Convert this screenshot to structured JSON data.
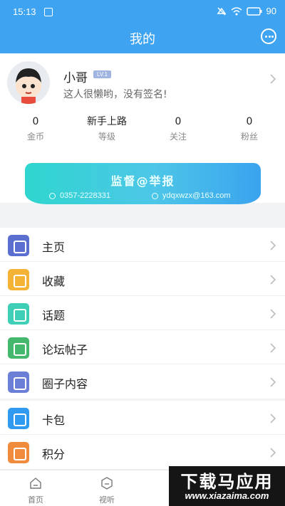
{
  "status_bar": {
    "time": "15:13",
    "battery": "90"
  },
  "header": {
    "title": "我的"
  },
  "profile": {
    "username": "小哥",
    "level": "LV.1",
    "signature": "这人很懒哟，没有签名!",
    "stats": [
      {
        "value": "0",
        "label": "金币"
      },
      {
        "value": "新手上路",
        "label": "等级"
      },
      {
        "value": "0",
        "label": "关注"
      },
      {
        "value": "0",
        "label": "粉丝"
      }
    ]
  },
  "banner": {
    "title": "监督@举报",
    "phone": "0357-2228331",
    "email": "ydqxwzx@163.com"
  },
  "menu_group_1": [
    {
      "label": "主页",
      "icon": "image-icon",
      "color": "#5b6fd1"
    },
    {
      "label": "收藏",
      "icon": "box-icon",
      "color": "#f5b335"
    },
    {
      "label": "话题",
      "icon": "hashtag-icon",
      "color": "#3ecfb6"
    },
    {
      "label": "论坛帖子",
      "icon": "chat-bubbles-icon",
      "color": "#45b86e"
    },
    {
      "label": "圈子内容",
      "icon": "circle-icon",
      "color": "#6b7fd6"
    }
  ],
  "menu_group_2": [
    {
      "label": "卡包",
      "icon": "card-icon",
      "color": "#2f9af0"
    },
    {
      "label": "积分",
      "icon": "coins-icon",
      "color": "#f08a3c"
    }
  ],
  "tabbar": [
    {
      "label": "首页",
      "icon": "home-icon"
    },
    {
      "label": "视听",
      "icon": "media-icon"
    }
  ],
  "watermark": {
    "title": "下载马应用",
    "url": "www.xiazaima.com"
  },
  "colors": {
    "primary": "#3ea3f0"
  }
}
